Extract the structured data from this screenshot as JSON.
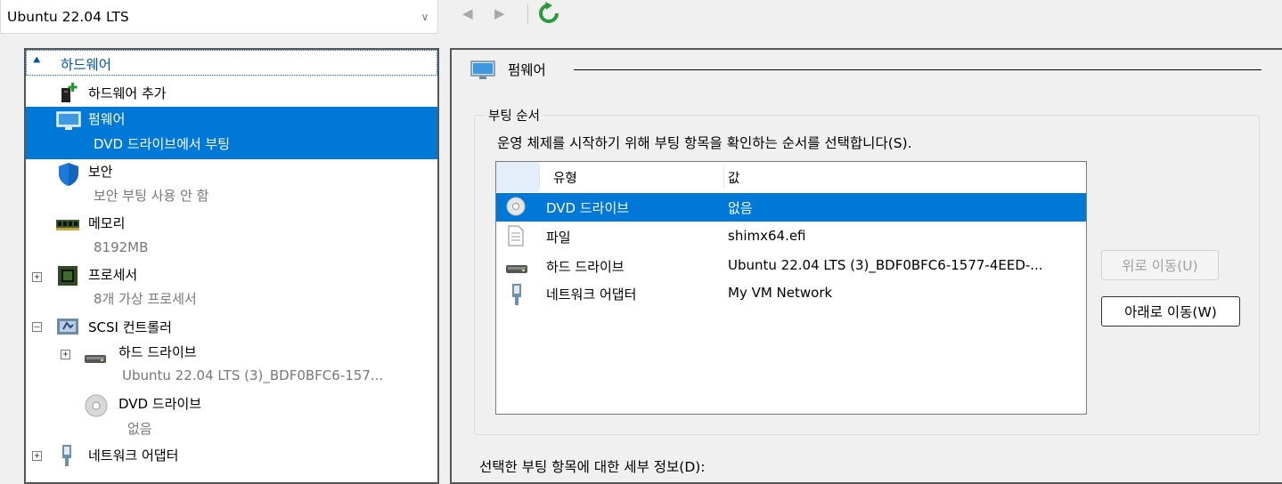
{
  "toolbar": {
    "vm_selected": "Ubuntu 22.04 LTS",
    "back_icon": "back-arrow-icon",
    "forward_icon": "forward-arrow-icon",
    "refresh_icon": "refresh-icon"
  },
  "tree": {
    "hardware_header": "하드웨어",
    "add_hardware": "하드웨어 추가",
    "firmware": {
      "label": "펌웨어",
      "detail": "DVD 드라이브에서 부팅"
    },
    "security": {
      "label": "보안",
      "detail": "보안 부팅 사용 안 함"
    },
    "memory": {
      "label": "메모리",
      "detail": "8192MB"
    },
    "processor": {
      "label": "프로세서",
      "detail": "8개 가상 프로세서"
    },
    "scsi": {
      "label": "SCSI 컨트롤러"
    },
    "hdd": {
      "label": "하드 드라이브",
      "detail": "Ubuntu 22.04 LTS (3)_BDF0BFC6-157..."
    },
    "dvd": {
      "label": "DVD 드라이브",
      "detail": "없음"
    },
    "network": {
      "label": "네트워크 어댑터"
    }
  },
  "firmware_panel": {
    "section_title": "펌웨어",
    "boot_order_group": "부팅 순서",
    "description": "운영 체제를 시작하기 위해 부팅 항목을 확인하는 순서를 선택합니다(S).",
    "columns": {
      "type": "유형",
      "value": "값"
    },
    "rows": [
      {
        "type": "DVD 드라이브",
        "value": "없음",
        "icon": "dvd-icon",
        "selected": true
      },
      {
        "type": "파일",
        "value": "shimx64.efi",
        "icon": "file-icon",
        "selected": false
      },
      {
        "type": "하드 드라이브",
        "value": "Ubuntu 22.04 LTS (3)_BDF0BFC6-1577-4EED-...",
        "icon": "hard-drive-icon",
        "selected": false
      },
      {
        "type": "네트워크 어댑터",
        "value": "My VM Network",
        "icon": "network-adapter-icon",
        "selected": false
      }
    ],
    "move_up": "위로 이동(U)",
    "move_down": "아래로 이동(W)",
    "details_label": "선택한 부팅 항목에 대한 세부 정보(D):"
  },
  "colors": {
    "selection": "#0078d7",
    "window_bg": "#f0f0f0",
    "refresh_green": "#2a9a3a"
  }
}
